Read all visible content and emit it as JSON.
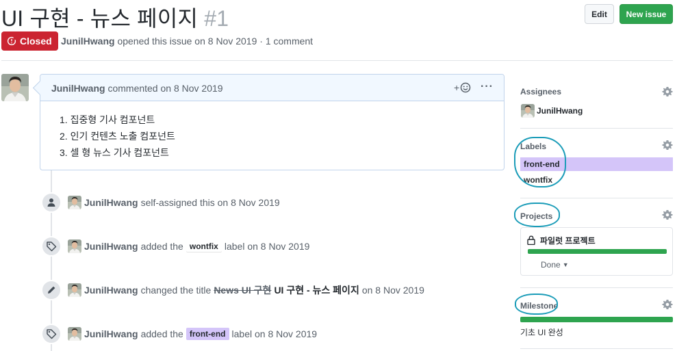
{
  "header": {
    "title": "UI 구현 - 뉴스 페이지",
    "number": "#1",
    "edit_label": "Edit",
    "new_issue_label": "New issue"
  },
  "status": {
    "state_label": "Closed",
    "author": "JunilHwang",
    "meta_text": " opened this issue on 8 Nov 2019 · 1 comment",
    "state_color": "#cb2431"
  },
  "comment": {
    "author": "JunilHwang",
    "meta": " commented on 8 Nov 2019",
    "reaction_prefix": "+",
    "items": [
      "1. 집중형 기사 컴포넌트",
      "2. 인기 컨텐츠 노출 컴포넌트",
      "3. 셀 형 뉴스 기사 컴포넌트"
    ]
  },
  "timeline": [
    {
      "icon": "person-icon",
      "author": "JunilHwang",
      "text": "self-assigned this on 8 Nov 2019"
    },
    {
      "icon": "tag-icon",
      "author": "JunilHwang",
      "pre": "added the",
      "label": "wontfix",
      "post": "label on 8 Nov 2019"
    },
    {
      "icon": "pencil-icon",
      "author": "JunilHwang",
      "pre": "changed the title",
      "old_title": "News UI 구현",
      "new_title": "UI 구현 - 뉴스 페이지",
      "post": "on 8 Nov 2019"
    },
    {
      "icon": "tag-icon",
      "author": "JunilHwang",
      "pre": "added the",
      "label": "front-end",
      "post": "label on 8 Nov 2019"
    }
  ],
  "sidebar": {
    "assignees_title": "Assignees",
    "assignee": "JunilHwang",
    "labels_title": "Labels",
    "labels": [
      "front-end",
      "wontfix"
    ],
    "projects_title": "Projects",
    "project_name": "파일럿 프로젝트",
    "project_status": "Done",
    "milestone_title": "Milestone",
    "milestone_name": "기초 UI 완성",
    "progress_color": "#2ea44f"
  },
  "colors": {
    "label_frontend": "#d4c5f9",
    "annotation": "#1a9cb8"
  }
}
